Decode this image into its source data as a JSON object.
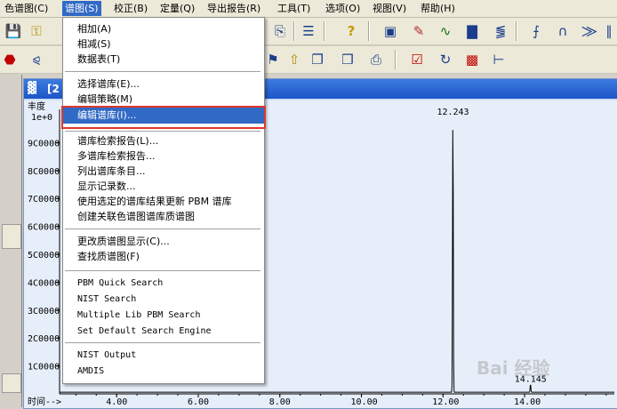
{
  "menubar": {
    "items": [
      {
        "label": "色谱图(C)"
      },
      {
        "label": "谱图(S)"
      },
      {
        "label": "校正(B)"
      },
      {
        "label": "定量(Q)"
      },
      {
        "label": "导出报告(R)"
      },
      {
        "label": "工具(T)"
      },
      {
        "label": "选项(O)"
      },
      {
        "label": "视图(V)"
      },
      {
        "label": "帮助(H)"
      }
    ]
  },
  "toolbar_icons": [
    "save-icon",
    "key-icon",
    "print-icon",
    "insert-icon",
    "document-icon",
    "help-icon",
    "picture-icon",
    "spectrum-icon",
    "chromatogram-icon",
    "bar-chart-icon",
    "peak-icon",
    "integration-icon",
    "baseline-icon",
    "peak-label-icon",
    "manual-integrate-icon",
    "ab-icon",
    "refresh-icon",
    "marker-icon",
    "range-icon",
    "stop-icon",
    "axis-icon",
    "flag-icon",
    "stack-icon",
    "copy-icon",
    "overlay-icon"
  ],
  "window": {
    "title": "[2"
  },
  "chart": {
    "y_label": "丰度",
    "y_top_label": "1e+0",
    "x_label": "时间-->",
    "peak_label_main": "12.243",
    "peak_label_small": "14.145",
    "accent": "#316ac5"
  },
  "chart_data": {
    "type": "line",
    "xlabel": "时间-->",
    "ylabel": "丰度",
    "x_ticks": [
      "4.00",
      "6.00",
      "8.00",
      "10.00",
      "12.00",
      "14.00"
    ],
    "y_ticks": [
      "9000000",
      "8000000",
      "7000000",
      "6000000",
      "5000000",
      "4000000",
      "3000000",
      "2000000",
      "1000000"
    ],
    "y_tick_labels": [
      "9C0000",
      "8C0000",
      "7C0000",
      "6C0000",
      "5C0000",
      "4C0000",
      "3C0000",
      "2C0000",
      "1C0000"
    ],
    "xlim": [
      2.6,
      16.2
    ],
    "ylim": [
      0,
      10000000
    ],
    "peaks": [
      {
        "x": 12.243,
        "y": 10000000,
        "label": "12.243"
      },
      {
        "x": 14.145,
        "y": 300000,
        "label": "14.145"
      }
    ]
  },
  "dropdown": {
    "items": [
      {
        "label": "相加(A)"
      },
      {
        "label": "相减(S)"
      },
      {
        "label": "数据表(T)"
      },
      {
        "label": "选择谱库(E)..."
      },
      {
        "label": "编辑策略(M)"
      },
      {
        "label": "编辑谱库(I)..."
      },
      {
        "label": "谱库检索报告(L)..."
      },
      {
        "label": "多谱库检索报告..."
      },
      {
        "label": "列出谱库条目..."
      },
      {
        "label": "显示记录数..."
      },
      {
        "label": "使用选定的谱库结果更新 PBM 谱库"
      },
      {
        "label": "创建关联色谱图谱库质谱图"
      },
      {
        "label": "更改质谱图显示(C)..."
      },
      {
        "label": "查找质谱图(F)"
      },
      {
        "label": "PBM Quick Search"
      },
      {
        "label": "NIST Search"
      },
      {
        "label": "Multiple Lib PBM Search"
      },
      {
        "label": "Set Default Search Engine"
      },
      {
        "label": "NIST Output"
      },
      {
        "label": "AMDIS"
      }
    ],
    "highlighted_index": 5
  },
  "watermark": "Bai 经验"
}
